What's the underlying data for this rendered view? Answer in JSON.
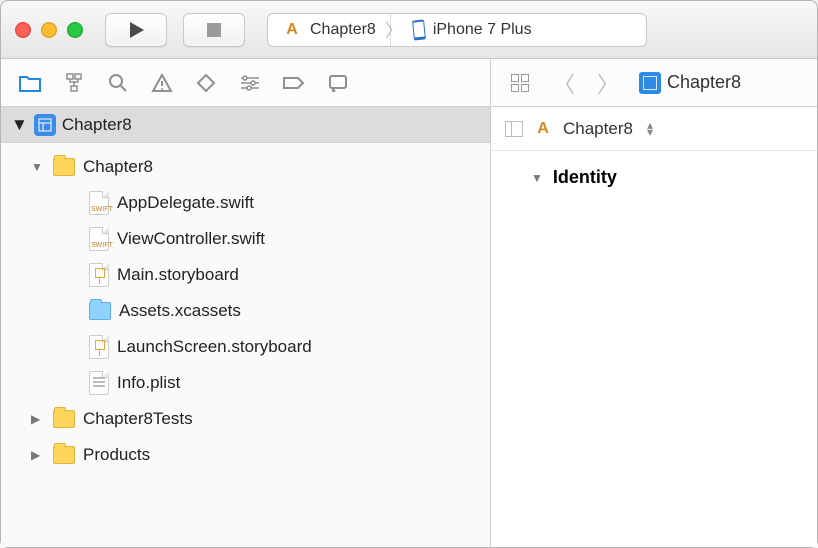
{
  "titlebar": {
    "scheme_project": "Chapter8",
    "scheme_device": "iPhone 7 Plus"
  },
  "navigator": {
    "project_name": "Chapter8",
    "groups": [
      {
        "name": "Chapter8",
        "expanded": true,
        "files": [
          {
            "name": "AppDelegate.swift",
            "type": "swift"
          },
          {
            "name": "ViewController.swift",
            "type": "swift"
          },
          {
            "name": "Main.storyboard",
            "type": "storyboard"
          },
          {
            "name": "Assets.xcassets",
            "type": "assets"
          },
          {
            "name": "LaunchScreen.storyboard",
            "type": "storyboard"
          },
          {
            "name": "Info.plist",
            "type": "plist"
          }
        ]
      },
      {
        "name": "Chapter8Tests",
        "expanded": false
      },
      {
        "name": "Products",
        "expanded": false
      }
    ]
  },
  "editor": {
    "breadcrumb_root": "Chapter8",
    "jump_bar": "Chapter8",
    "sections": [
      {
        "title": "Identity",
        "expanded": true
      }
    ]
  }
}
